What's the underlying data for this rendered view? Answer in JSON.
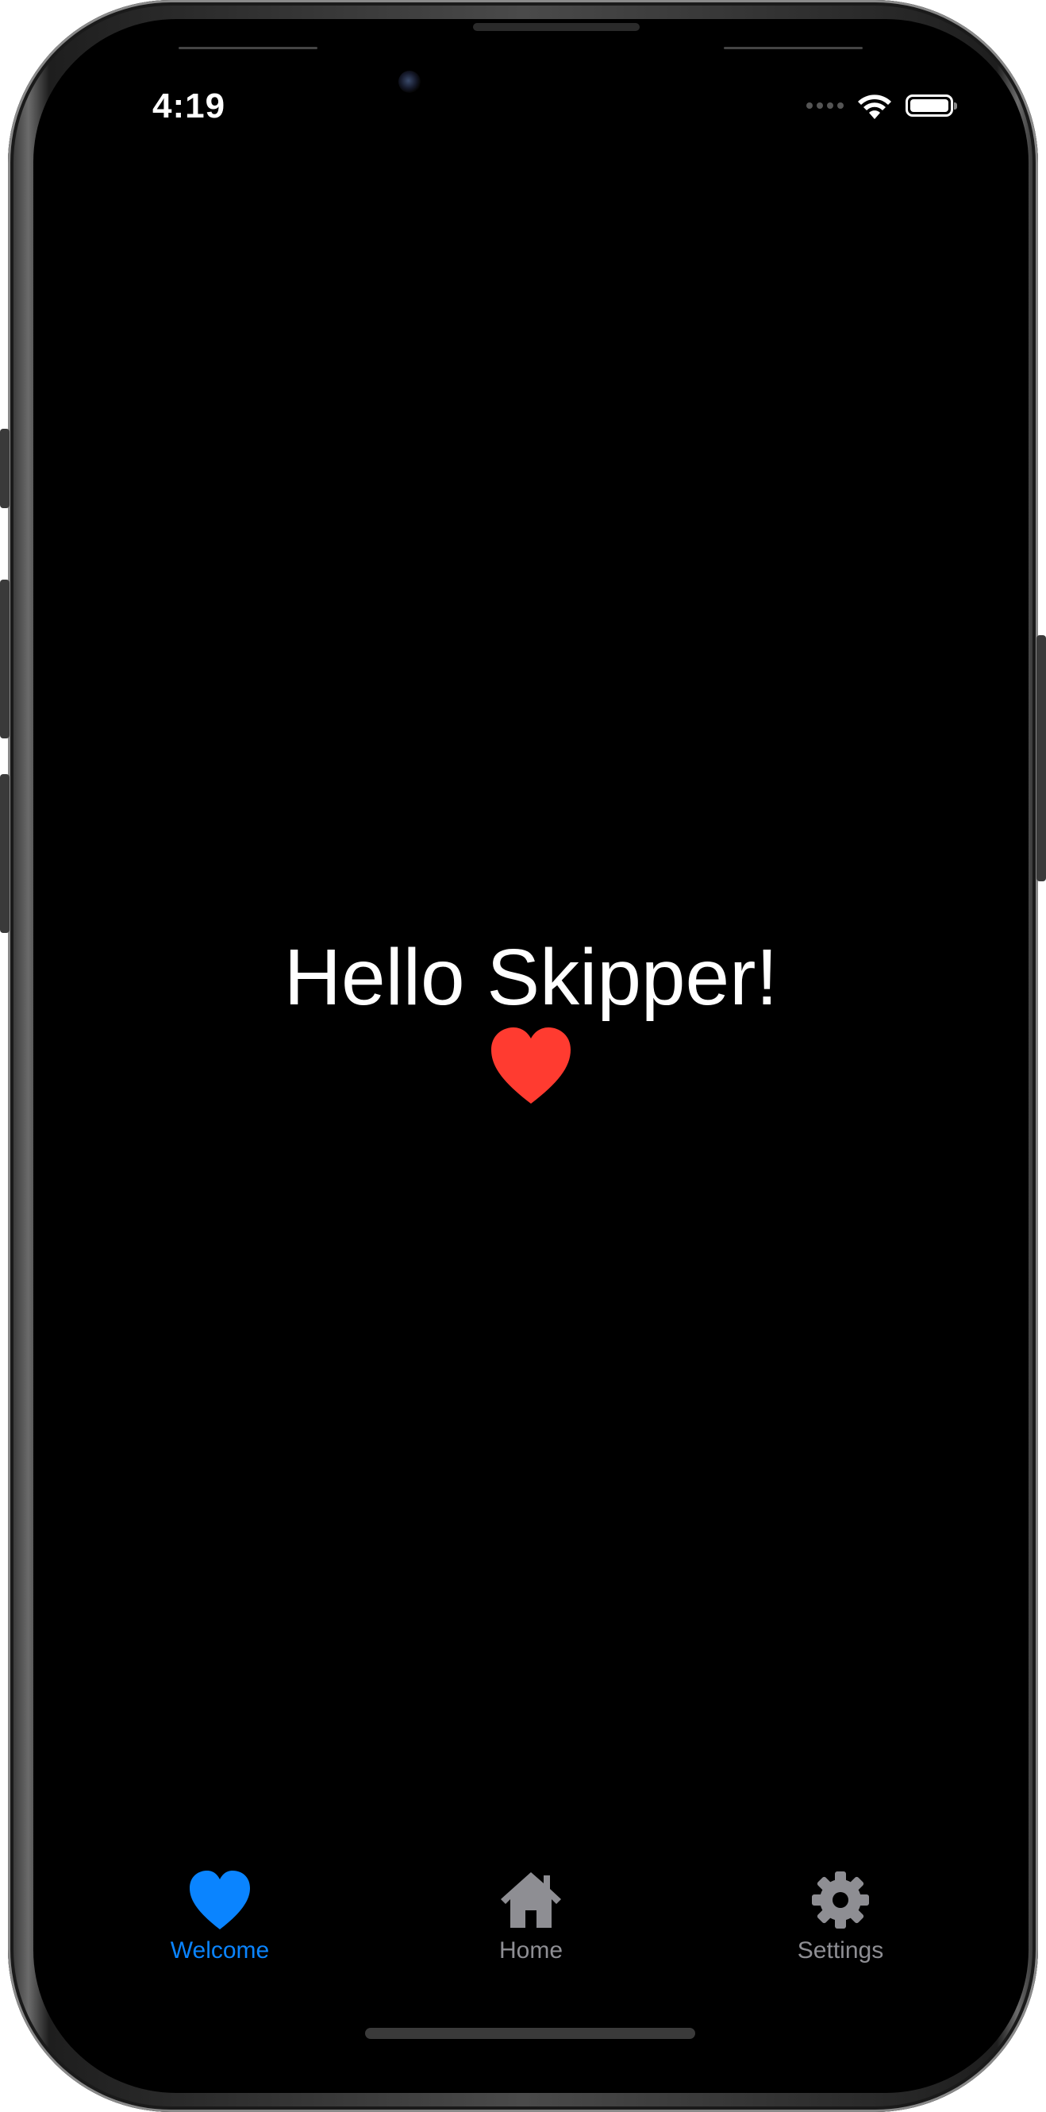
{
  "status_bar": {
    "time": "4:19",
    "signal_icon": "cellular-dots-icon",
    "wifi_icon": "wifi-icon",
    "battery_icon": "battery-icon"
  },
  "main": {
    "greeting": "Hello Skipper!",
    "heart_icon": "heart-icon",
    "heart_color": "#ff3b30"
  },
  "tabbar": {
    "tabs": [
      {
        "label": "Welcome",
        "icon": "heart-icon",
        "selected": true
      },
      {
        "label": "Home",
        "icon": "house-icon",
        "selected": false
      },
      {
        "label": "Settings",
        "icon": "gear-icon",
        "selected": false
      }
    ],
    "active_color": "#0a84ff",
    "inactive_color": "#8e8e93"
  },
  "colors": {
    "background": "#000000",
    "text": "#ffffff"
  }
}
